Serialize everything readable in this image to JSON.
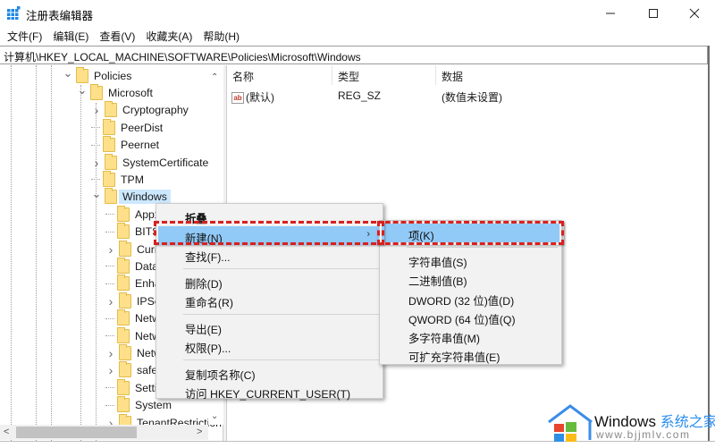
{
  "window": {
    "title": "注册表编辑器",
    "controls": {
      "minimize": "—",
      "maximize": "☐",
      "close": "✕"
    }
  },
  "menubar": {
    "items": [
      "文件(F)",
      "编辑(E)",
      "查看(V)",
      "收藏夹(A)",
      "帮助(H)"
    ]
  },
  "address": {
    "path": "计算机\\HKEY_LOCAL_MACHINE\\SOFTWARE\\Policies\\Microsoft\\Windows"
  },
  "tree": {
    "nodes": [
      {
        "label": "Policies",
        "expander": "expanded"
      },
      {
        "label": "Microsoft",
        "expander": "expanded"
      },
      {
        "label": "Cryptography",
        "expander": "collapsed"
      },
      {
        "label": "PeerDist",
        "expander": "none"
      },
      {
        "label": "Peernet",
        "expander": "none"
      },
      {
        "label": "SystemCertificates",
        "expander": "collapsed"
      },
      {
        "label": "TPM",
        "expander": "none"
      },
      {
        "label": "Windows",
        "expander": "expanded",
        "selected": true
      },
      {
        "label": "Appx",
        "expander": "none"
      },
      {
        "label": "BITS",
        "expander": "none"
      },
      {
        "label": "Curren",
        "expander": "collapsed"
      },
      {
        "label": "DataCo",
        "expander": "none"
      },
      {
        "label": "Enhanc",
        "expander": "none"
      },
      {
        "label": "IPSec",
        "expander": "collapsed"
      },
      {
        "label": "Netwo",
        "expander": "none"
      },
      {
        "label": "Netwo",
        "expander": "none"
      },
      {
        "label": "Netwo",
        "expander": "collapsed"
      },
      {
        "label": "safer",
        "expander": "collapsed"
      },
      {
        "label": "Setting",
        "expander": "none"
      },
      {
        "label": "System",
        "expander": "none"
      },
      {
        "label": "TenantRestriction",
        "expander": "collapsed"
      }
    ]
  },
  "list": {
    "columns": [
      "名称",
      "类型",
      "数据"
    ],
    "rows": [
      {
        "icon": "ab",
        "name": "(默认)",
        "type": "REG_SZ",
        "data": "(数值未设置)"
      }
    ]
  },
  "context_menu": {
    "items": [
      {
        "label": "折叠",
        "bold": true
      },
      {
        "label": "新建(N)",
        "highlighted": true,
        "submenu": true,
        "arrow": "›"
      },
      {
        "label": "查找(F)..."
      },
      {
        "separator": true
      },
      {
        "label": "删除(D)"
      },
      {
        "label": "重命名(R)"
      },
      {
        "separator": true
      },
      {
        "label": "导出(E)"
      },
      {
        "label": "权限(P)..."
      },
      {
        "separator": true
      },
      {
        "label": "复制项名称(C)"
      },
      {
        "label": "访问 HKEY_CURRENT_USER(T)"
      }
    ]
  },
  "submenu": {
    "items": [
      {
        "label": "项(K)",
        "highlighted": true
      },
      {
        "separator": true
      },
      {
        "label": "字符串值(S)"
      },
      {
        "label": "二进制值(B)"
      },
      {
        "label": "DWORD (32 位)值(D)"
      },
      {
        "label": "QWORD (64 位)值(Q)"
      },
      {
        "label": "多字符串值(M)"
      },
      {
        "label": "可扩充字符串值(E)"
      }
    ]
  },
  "watermark": {
    "brand": "Windows",
    "brand_cn": "系统之家",
    "url": "www.bjjmlv.com"
  },
  "colors": {
    "highlight": "#91c9f7",
    "selection": "#cce8ff",
    "annotation_red": "#d9201e",
    "folder": "#ffe08a"
  }
}
